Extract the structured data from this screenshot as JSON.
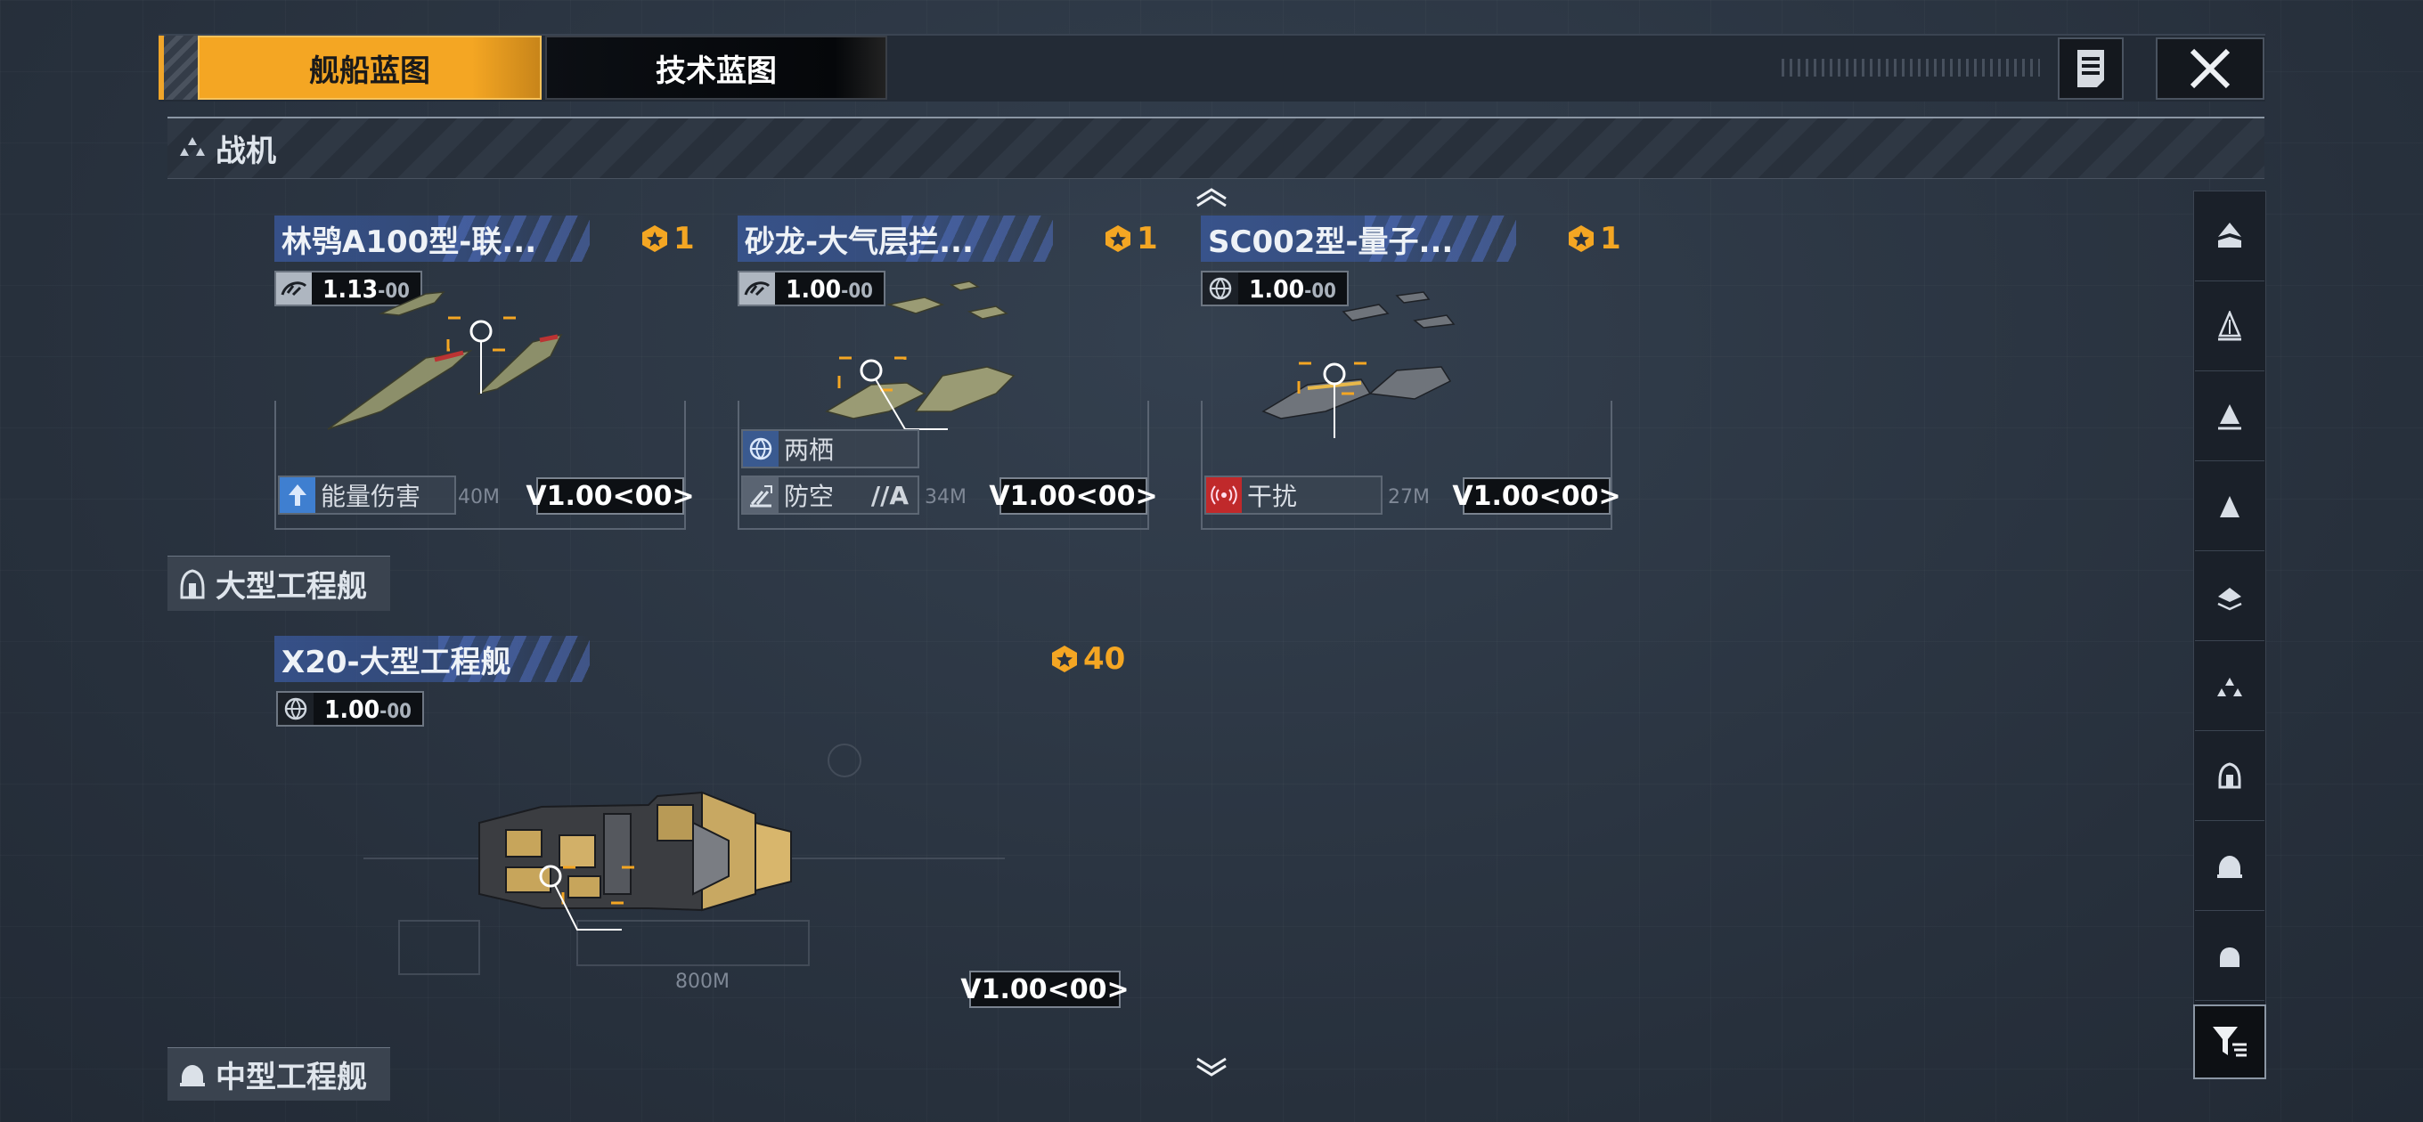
{
  "tabs": {
    "active": "舰船蓝图",
    "inactive": "技术蓝图"
  },
  "sections": [
    {
      "title": "战机",
      "icon": "fighter-group-icon"
    },
    {
      "title": "大型工程舰",
      "icon": "large-engineering-ship-icon"
    },
    {
      "title": "中型工程舰",
      "icon": "medium-engineering-ship-icon"
    }
  ],
  "cards": [
    {
      "name": "林鸮A100型-联...",
      "rarity": "1",
      "version": "1.13",
      "version_suffix": "-00",
      "version_icon": "speed-icon",
      "tags": [
        {
          "label": "能量伤害",
          "icon": "energy-damage-icon"
        }
      ],
      "tag_suffix": "",
      "distance": "40M",
      "vbadge": "V1.00<00>"
    },
    {
      "name": "砂龙-大气层拦...",
      "rarity": "1",
      "version": "1.00",
      "version_suffix": "-00",
      "version_icon": "speed-icon",
      "tags": [
        {
          "label": "两栖",
          "icon": "amphibious-icon"
        },
        {
          "label": "防空",
          "icon": "anti-air-icon"
        }
      ],
      "tag_suffix": "//A",
      "distance": "34M",
      "vbadge": "V1.00<00>"
    },
    {
      "name": "SC002型-量子...",
      "rarity": "1",
      "version": "1.00",
      "version_suffix": "-00",
      "version_icon": "globe-icon",
      "tags": [
        {
          "label": "干扰",
          "icon": "jamming-icon"
        }
      ],
      "tag_suffix": "",
      "distance": "27M",
      "vbadge": "V1.00<00>"
    },
    {
      "name": "X20-大型工程舰",
      "rarity": "40",
      "version": "1.00",
      "version_suffix": "-00",
      "version_icon": "globe-icon",
      "tags": [],
      "tag_suffix": "",
      "distance": "800M",
      "vbadge": "V1.00<00>"
    }
  ],
  "rail_icons": [
    "flagship-class-icon",
    "battleship-class-icon",
    "carrier-class-icon",
    "cruiser-class-icon",
    "destroyer-class-icon",
    "fighter-group-icon",
    "large-engineering-ship-icon",
    "medium-engineering-ship-icon",
    "small-ship-icon"
  ],
  "colors": {
    "accent": "#f4a623",
    "title_bar": "#3a5aa0",
    "jamming": "#c0292b",
    "energy": "#3f7fd0"
  }
}
